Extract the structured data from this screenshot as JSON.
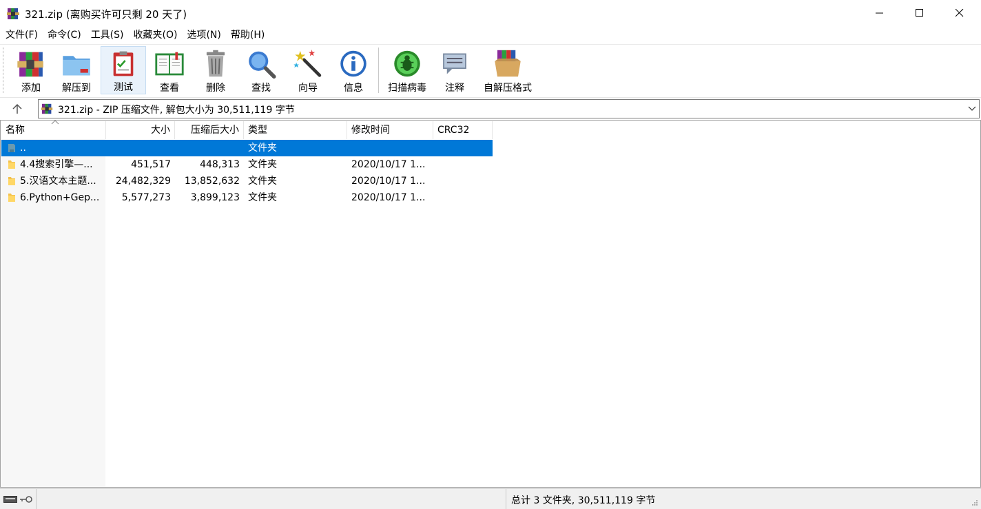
{
  "window": {
    "title": "321.zip (离购买许可只剩 20 天了)",
    "icons": {
      "app": "winrar-books-icon",
      "minimize": "minimize-icon",
      "maximize": "maximize-icon",
      "close": "close-icon"
    }
  },
  "menu": [
    "文件(F)",
    "命令(C)",
    "工具(S)",
    "收藏夹(O)",
    "选项(N)",
    "帮助(H)"
  ],
  "toolbar": {
    "buttons": [
      {
        "label": "添加",
        "icon": "archive-add-icon"
      },
      {
        "label": "解压到",
        "icon": "extract-folder-icon"
      },
      {
        "label": "测试",
        "icon": "test-clipboard-icon",
        "active": true
      },
      {
        "label": "查看",
        "icon": "view-book-icon"
      },
      {
        "label": "删除",
        "icon": "trash-icon"
      },
      {
        "label": "查找",
        "icon": "magnifier-icon"
      },
      {
        "label": "向导",
        "icon": "wizard-wand-icon"
      },
      {
        "label": "信息",
        "icon": "info-icon"
      },
      {
        "label": "扫描病毒",
        "icon": "virus-scan-icon"
      },
      {
        "label": "注释",
        "icon": "comment-icon"
      },
      {
        "label": "自解压格式",
        "icon": "sfx-box-icon"
      }
    ]
  },
  "address": {
    "path": "321.zip - ZIP 压缩文件, 解包大小为 30,511,119 字节",
    "icons": {
      "up": "up-arrow-icon",
      "dropdown": "chevron-down-icon"
    }
  },
  "file_list": {
    "columns": [
      "名称",
      "大小",
      "压缩后大小",
      "类型",
      "修改时间",
      "CRC32"
    ],
    "rows": [
      {
        "name": "..",
        "size": "",
        "packed": "",
        "type": "文件夹",
        "modified": "",
        "crc": "",
        "selected": true,
        "icon": "parent-folder-icon"
      },
      {
        "name": "4.4搜索引擎—...",
        "size": "451,517",
        "packed": "448,313",
        "type": "文件夹",
        "modified": "2020/10/17 1...",
        "crc": "",
        "icon": "folder-icon"
      },
      {
        "name": "5.汉语文本主题...",
        "size": "24,482,329",
        "packed": "13,852,632",
        "type": "文件夹",
        "modified": "2020/10/17 1...",
        "crc": "",
        "icon": "folder-icon"
      },
      {
        "name": "6.Python+Gep...",
        "size": "5,577,273",
        "packed": "3,899,123",
        "type": "文件夹",
        "modified": "2020/10/17 1...",
        "crc": "",
        "icon": "folder-icon"
      }
    ]
  },
  "status": {
    "text": "总计 3 文件夹, 30,511,119 字节",
    "icons": [
      "keyboard-icon",
      "key-icon"
    ]
  },
  "colors": {
    "selection": "#0078d7",
    "folder": "#f3c14c"
  }
}
